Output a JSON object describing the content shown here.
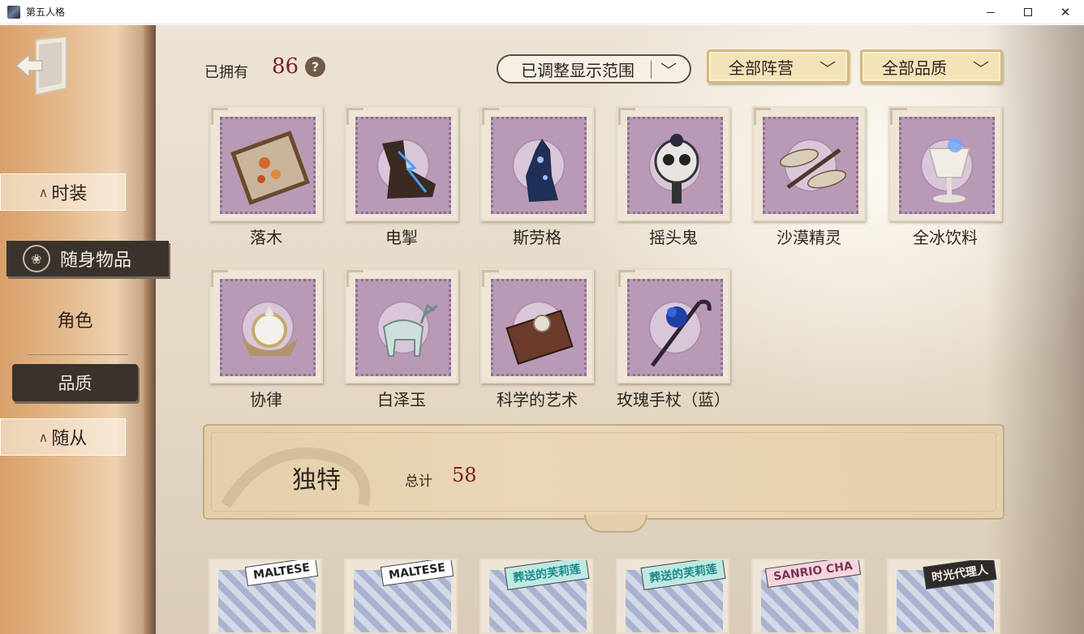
{
  "window": {
    "title": "第五人格",
    "icons": {
      "app": "game-app-icon",
      "minimize": "minimize-icon",
      "maximize": "maximize-icon",
      "close": "close-icon"
    }
  },
  "sidebar": {
    "exit_icon": "exit-door-icon",
    "tabs": [
      {
        "label": "时装",
        "state": "normal"
      },
      {
        "label": "随身物品",
        "state": "selected",
        "icon": "shield-emblem-icon"
      },
      {
        "label": "角色",
        "state": "sub-normal"
      },
      {
        "label": "品质",
        "state": "sub-selected"
      },
      {
        "label": "随从",
        "state": "normal"
      }
    ]
  },
  "header": {
    "owned_label": "已拥有",
    "owned_count": "86",
    "help_icon": "help-question-icon",
    "range_dropdown": "已调整显示范围",
    "camp_dropdown": "全部阵营",
    "quality_dropdown": "全部品质"
  },
  "items": [
    {
      "name": "落木"
    },
    {
      "name": "电掣"
    },
    {
      "name": "斯劳格"
    },
    {
      "name": "摇头鬼"
    },
    {
      "name": "沙漠精灵"
    },
    {
      "name": "全冰饮料"
    },
    {
      "name": "协律"
    },
    {
      "name": "白泽玉"
    },
    {
      "name": "科学的艺术"
    },
    {
      "name": "玫瑰手杖（蓝）"
    }
  ],
  "rarity_banner": {
    "title": "独特",
    "total_label": "总计",
    "total": "58"
  },
  "bottom_row": [
    {
      "tag": "MALTESE"
    },
    {
      "tag": "MALTESE"
    },
    {
      "tag": "葬送的芙莉莲"
    },
    {
      "tag": "葬送的芙莉莲"
    },
    {
      "tag": "SANRIO CHA"
    },
    {
      "tag": "时光代理人"
    }
  ],
  "colors": {
    "accent_red": "#7a1f22",
    "sidebar_selected": "#3a332d",
    "dropdown_gold": "#f3e3b8",
    "stamp_purple": "#b89ab7"
  }
}
